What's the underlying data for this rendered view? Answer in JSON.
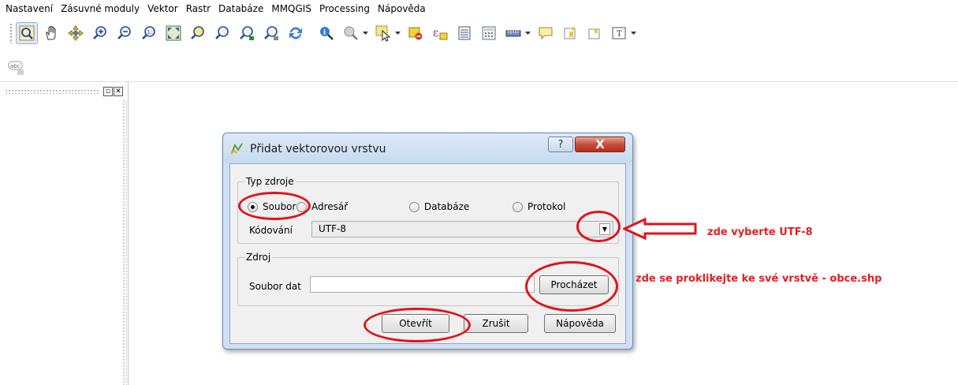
{
  "menu": [
    "Nastavení",
    "Zásuvné moduly",
    "Vektor",
    "Rastr",
    "Databáze",
    "MMQGIS",
    "Processing",
    "Nápověda"
  ],
  "dialog": {
    "title": "Přidat vektorovou vrstvu",
    "help_glyph": "?",
    "close_glyph": "X",
    "source_type": {
      "legend": "Typ zdroje",
      "options": [
        "Soubor",
        "Adresář",
        "Databáze",
        "Protokol"
      ],
      "selected": "Soubor"
    },
    "encoding": {
      "label": "Kódování",
      "value": "UTF-8"
    },
    "source": {
      "legend": "Zdroj",
      "label": "Soubor dat",
      "value": "",
      "browse_label": "Procházet"
    },
    "buttons": {
      "open": "Otevřít",
      "cancel": "Zrušit",
      "help": "Nápověda"
    }
  },
  "annotations": {
    "utf8_note": "zde vyberte UTF-8",
    "layer_note": "zde se proklikejte ke své vrstvě -  obce.shp",
    "color": "#e31e24"
  },
  "toolbar_icons": [
    "pan-map-icon",
    "pan-hand-icon",
    "pan-to-selection-icon",
    "zoom-in-icon",
    "zoom-out-icon",
    "zoom-native-icon",
    "zoom-full-icon",
    "zoom-to-selection-icon",
    "zoom-to-layer-icon",
    "zoom-last-icon",
    "zoom-next-icon",
    "refresh-icon",
    "identify-icon",
    "feature-action-icon",
    "select-features-icon",
    "deselect-icon",
    "select-by-expression-icon",
    "attribute-table-icon",
    "field-calculator-icon",
    "measure-icon",
    "map-tips-icon",
    "new-bookmark-icon",
    "show-bookmarks-icon",
    "text-annotation-icon"
  ]
}
